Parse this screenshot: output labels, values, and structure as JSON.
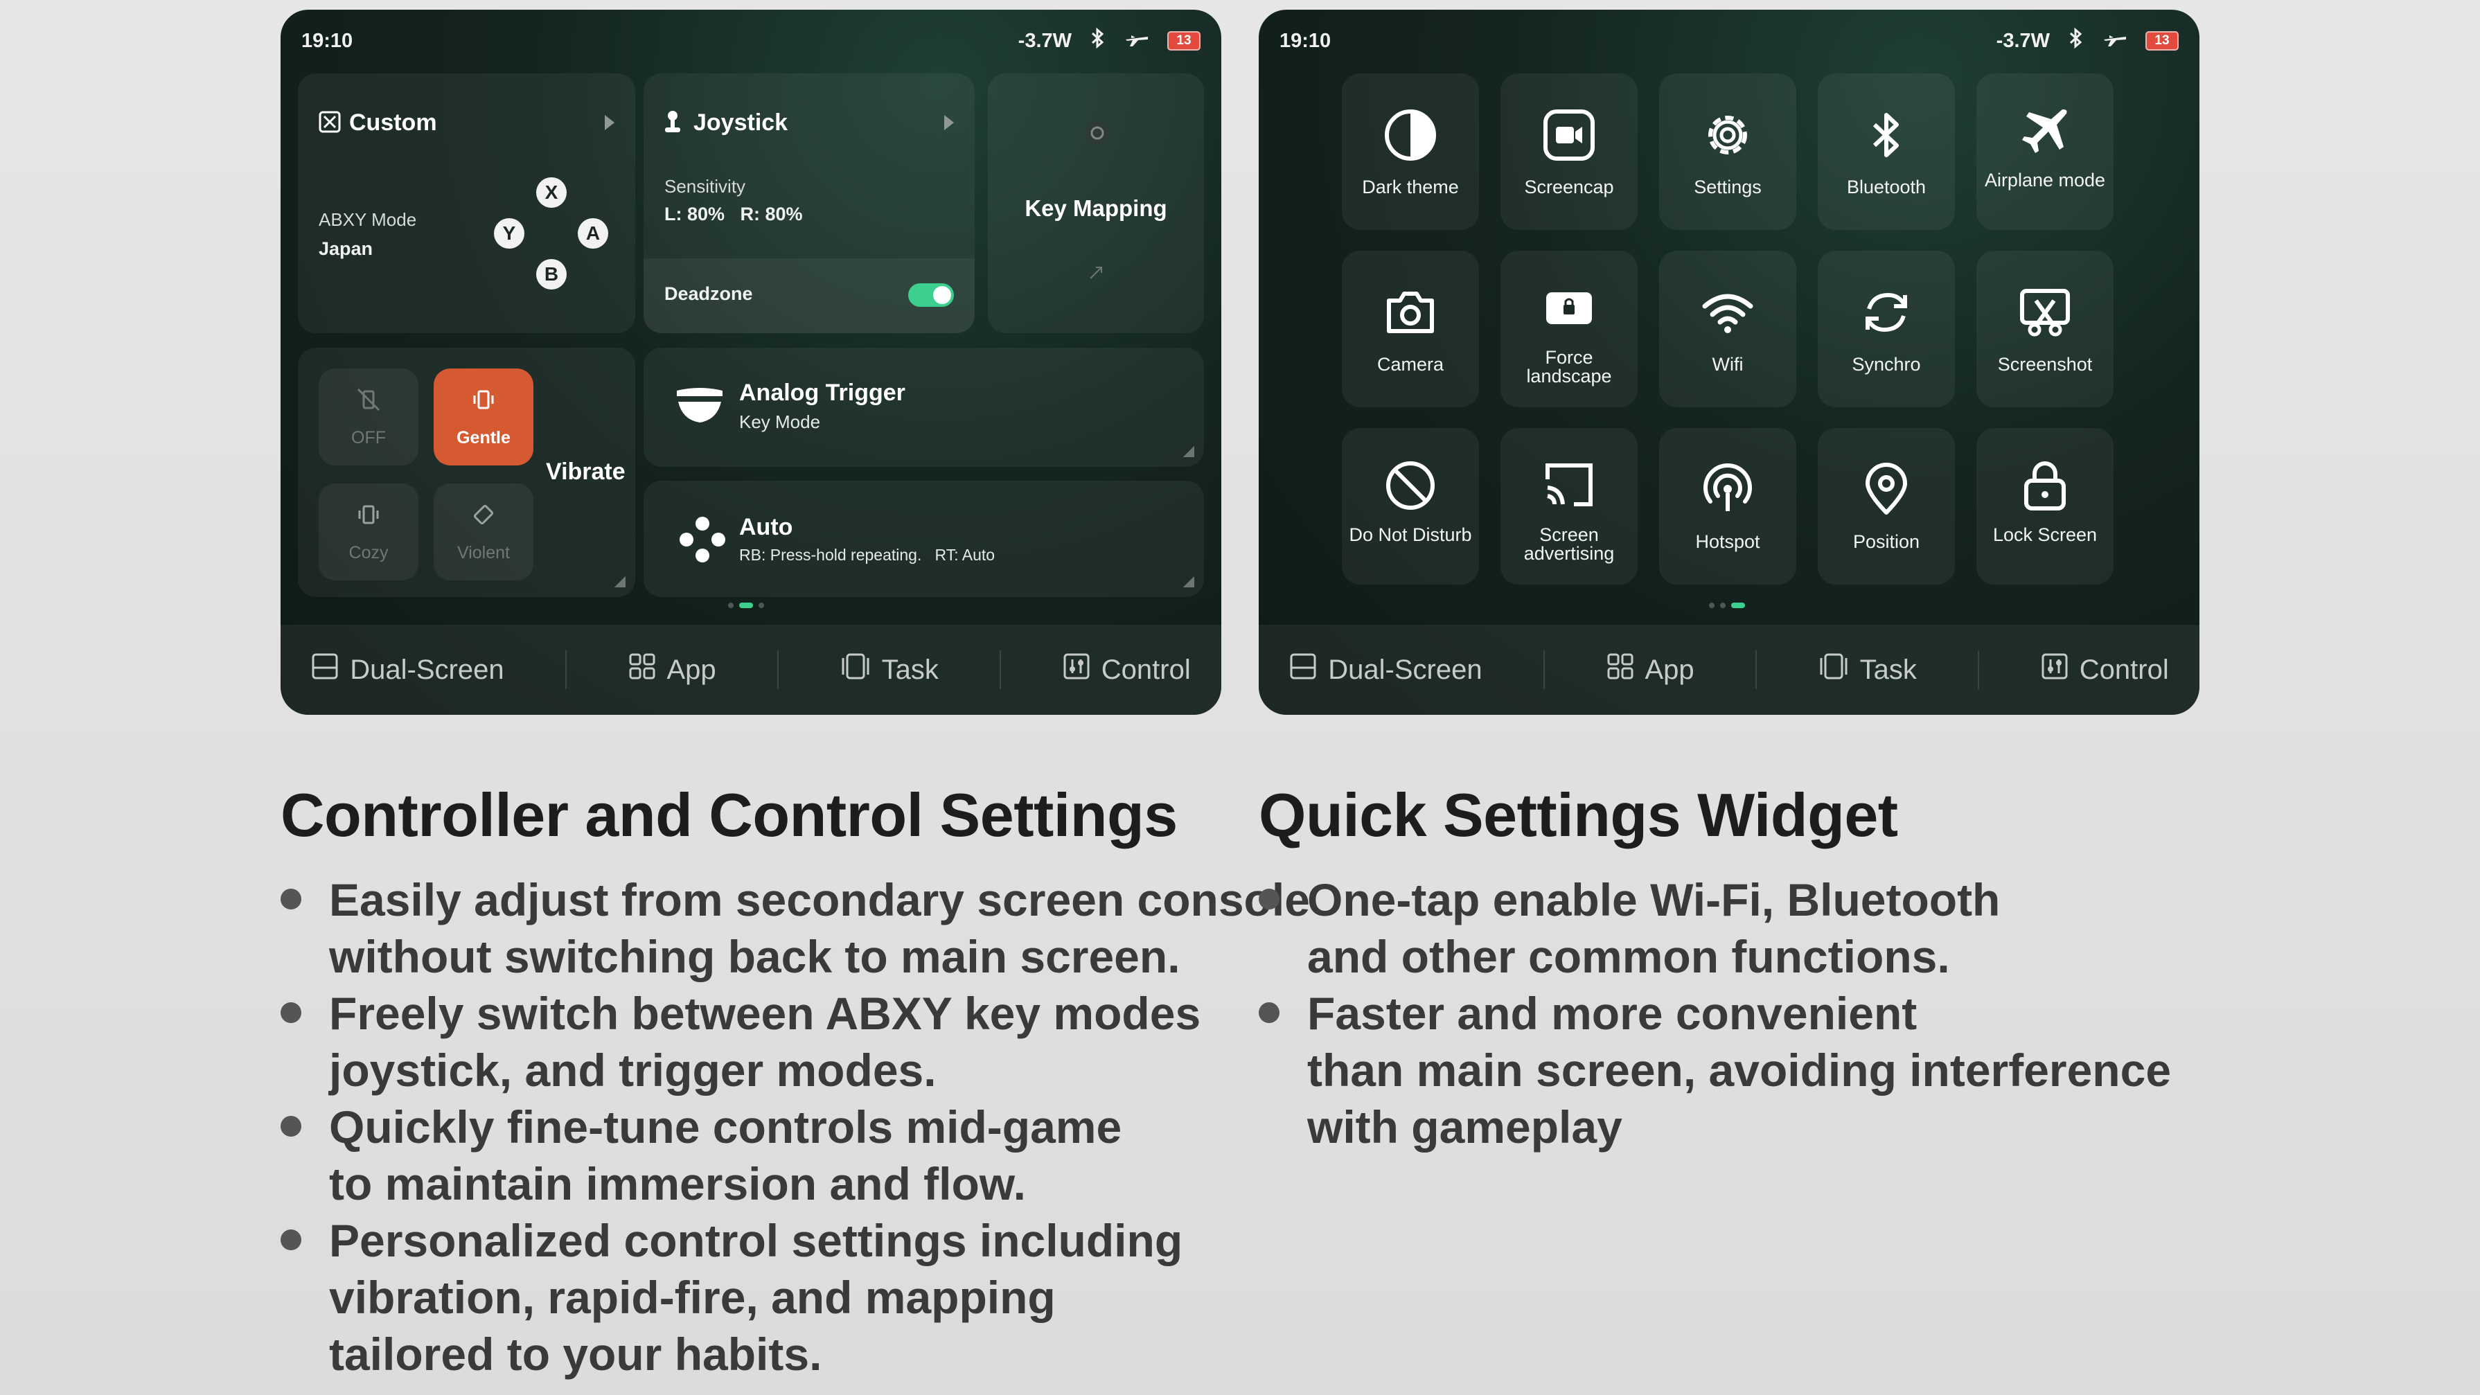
{
  "status": {
    "time": "19:10",
    "power": "-3.7W",
    "battery": "13"
  },
  "left_panel": {
    "custom": {
      "title": "Custom",
      "abxy_label": "ABXY Mode",
      "abxy_value": "Japan",
      "keys": [
        "X",
        "Y",
        "A",
        "B"
      ]
    },
    "joystick": {
      "title": "Joystick",
      "sensitivity_label": "Sensitivity",
      "sensitivity_value": "L: 80%   R: 80%",
      "deadzone_label": "Deadzone"
    },
    "key_mapping": {
      "title": "Key Mapping"
    },
    "vibrate": {
      "title": "Vibrate",
      "options": [
        "OFF",
        "Gentle",
        "Cozy",
        "Violent"
      ],
      "selected": "Gentle"
    },
    "analog_trigger": {
      "title": "Analog Trigger",
      "subtitle": "Key Mode"
    },
    "auto": {
      "title": "Auto",
      "subtitle": "RB: Press-hold repeating.   RT: Auto"
    }
  },
  "right_panel": {
    "tiles": [
      {
        "label": "Dark theme",
        "icon": "half-circle-icon"
      },
      {
        "label": "Screencap",
        "icon": "video-icon"
      },
      {
        "label": "Settings",
        "icon": "gear-icon"
      },
      {
        "label": "Bluetooth",
        "icon": "bluetooth-icon"
      },
      {
        "label": "Airplane mode",
        "icon": "airplane-icon"
      },
      {
        "label": "Camera",
        "icon": "camera-icon"
      },
      {
        "label": "Force landscape",
        "icon": "lock-rotate-icon"
      },
      {
        "label": "Wifi",
        "icon": "wifi-icon"
      },
      {
        "label": "Synchro",
        "icon": "sync-icon"
      },
      {
        "label": "Screenshot",
        "icon": "screenshot-icon"
      },
      {
        "label": "Do Not Disturb",
        "icon": "block-icon"
      },
      {
        "label": "Screen advertising",
        "icon": "cast-icon"
      },
      {
        "label": "Hotspot",
        "icon": "hotspot-icon"
      },
      {
        "label": "Position",
        "icon": "location-pin-icon"
      },
      {
        "label": "Lock Screen",
        "icon": "lock-icon"
      }
    ]
  },
  "nav": [
    "Dual-Screen",
    "App",
    "Task",
    "Control"
  ],
  "left_text": {
    "heading": "Controller and Control Settings",
    "bullets": [
      "Easily adjust from secondary screen console\nwithout switching back to main screen.",
      "Freely switch between ABXY key modes\njoystick, and trigger modes.",
      "Quickly fine-tune controls mid-game\nto maintain immersion and flow.",
      "Personalized control settings including\nvibration, rapid-fire, and mapping\ntailored to your habits."
    ]
  },
  "right_text": {
    "heading": "Quick Settings Widget",
    "bullets": [
      "One-tap enable Wi-Fi, Bluetooth\nand other common functions.",
      "Faster and more convenient\nthan main screen, avoiding interference\nwith gameplay"
    ]
  },
  "colors": {
    "accent_green": "#3ccf8e",
    "accent_orange": "#d65a31",
    "battery_red": "#e14a3c"
  }
}
